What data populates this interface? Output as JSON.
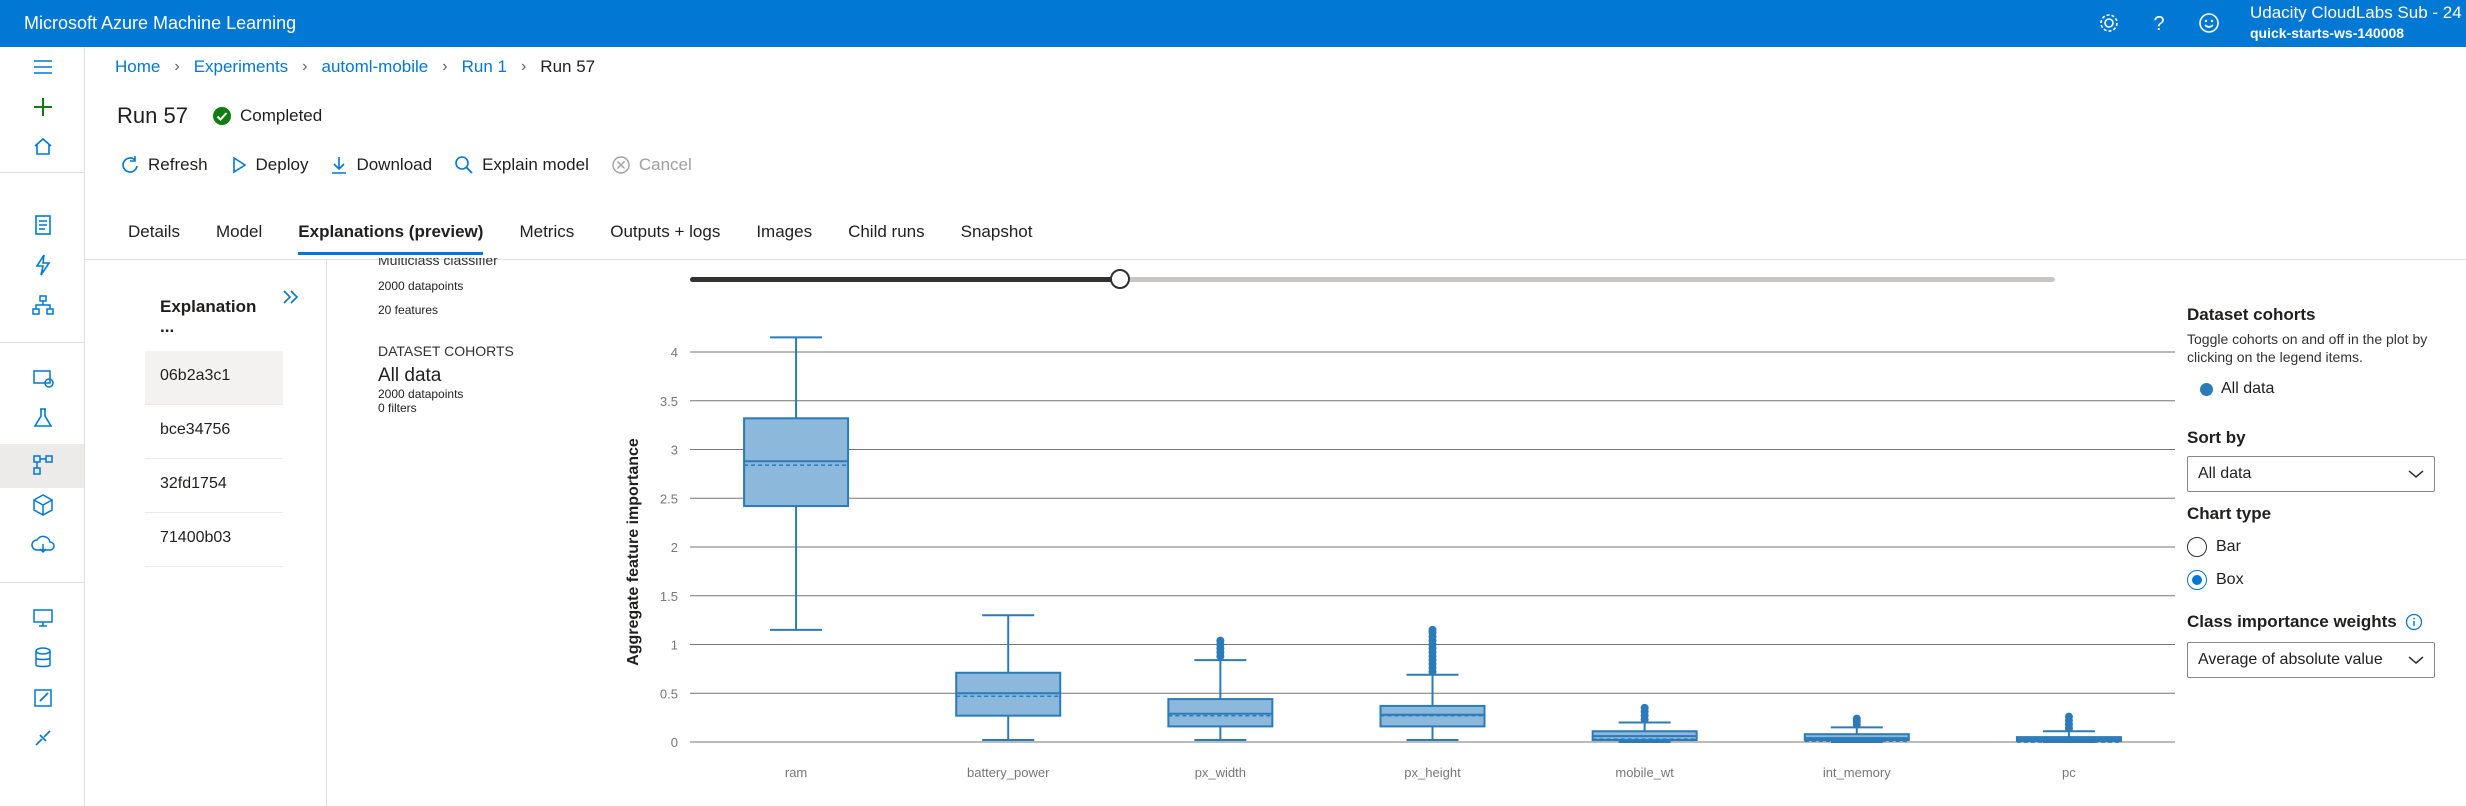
{
  "app": {
    "title": "Microsoft Azure Machine Learning"
  },
  "account": {
    "name": "Udacity CloudLabs Sub - 24",
    "workspace": "quick-starts-ws-140008"
  },
  "topbar_icons": [
    "settings-icon",
    "help-icon",
    "feedback-smiley-icon"
  ],
  "breadcrumb": [
    "Home",
    "Experiments",
    "automl-mobile",
    "Run 1",
    "Run 57"
  ],
  "run": {
    "title": "Run 57",
    "status": "Completed"
  },
  "toolbar": {
    "refresh": "Refresh",
    "deploy": "Deploy",
    "download": "Download",
    "explain": "Explain model",
    "cancel": "Cancel"
  },
  "tabs": [
    "Details",
    "Model",
    "Explanations (preview)",
    "Metrics",
    "Outputs + logs",
    "Images",
    "Child runs",
    "Snapshot"
  ],
  "explanations": {
    "header": "Explanation ...",
    "items": [
      "06b2a3c1",
      "bce34756",
      "32fd1754",
      "71400b03"
    ]
  },
  "summary": {
    "model_type_cut": "Multiclass classifier",
    "datapoints": "2000 datapoints",
    "features": "20 features",
    "cohorts_label": "DATASET COHORTS",
    "cohort_name": "All data",
    "cohort_points": "2000 datapoints",
    "cohort_filters": "0 filters"
  },
  "slider": {
    "value_fraction": 0.32
  },
  "right_panel": {
    "cohorts_title": "Dataset cohorts",
    "cohorts_desc": "Toggle cohorts on and off in the plot by clicking on the legend items.",
    "legend_item": "All data",
    "sort_title": "Sort by",
    "sort_value": "All data",
    "chart_type_title": "Chart type",
    "opt_bar": "Bar",
    "opt_box": "Box",
    "selected": "Box",
    "weights_title": "Class importance weights",
    "weights_value": "Average of absolute value"
  },
  "colors": {
    "accent": "#0078d4",
    "box_fill": "#8bb8db",
    "box_stroke": "#2b7bb9"
  },
  "chart_data": {
    "type": "box",
    "ylabel": "Aggregate feature importance",
    "ylim": [
      0,
      4.2
    ],
    "yticks": [
      "0",
      "0.5",
      "1",
      "1.5",
      "2",
      "2.5",
      "3",
      "3.5",
      "4"
    ],
    "series": [
      {
        "category": "ram",
        "min": 1.15,
        "q1": 2.42,
        "median": 2.88,
        "mean": 2.87,
        "q3": 3.32,
        "max": 4.15,
        "outliers": []
      },
      {
        "category": "battery_power",
        "min": 0.02,
        "q1": 0.27,
        "median": 0.5,
        "mean": 0.5,
        "q3": 0.71,
        "max": 1.3,
        "outliers": []
      },
      {
        "category": "px_width",
        "min": 0.02,
        "q1": 0.16,
        "median": 0.29,
        "mean": 0.3,
        "q3": 0.44,
        "max": 0.84,
        "outliers": [
          0.88,
          0.92,
          0.96,
          1.0,
          1.04
        ]
      },
      {
        "category": "px_height",
        "min": 0.02,
        "q1": 0.16,
        "median": 0.28,
        "mean": 0.3,
        "q3": 0.37,
        "max": 0.69,
        "outliers": [
          0.72,
          0.76,
          0.8,
          0.84,
          0.88,
          0.92,
          0.96,
          1.0,
          1.04,
          1.08,
          1.12,
          1.15
        ]
      },
      {
        "category": "mobile_wt",
        "min": 0.0,
        "q1": 0.02,
        "median": 0.06,
        "mean": 0.06,
        "q3": 0.11,
        "max": 0.2,
        "outliers": [
          0.23,
          0.27,
          0.31,
          0.35
        ]
      },
      {
        "category": "int_memory",
        "min": 0.0,
        "q1": 0.02,
        "median": 0.04,
        "mean": 0.04,
        "q3": 0.08,
        "max": 0.15,
        "outliers": [
          0.18,
          0.21,
          0.24
        ]
      },
      {
        "category": "pc",
        "min": 0.0,
        "q1": 0.01,
        "median": 0.03,
        "mean": 0.03,
        "q3": 0.05,
        "max": 0.11,
        "outliers": [
          0.14,
          0.18,
          0.22,
          0.26
        ]
      }
    ]
  }
}
